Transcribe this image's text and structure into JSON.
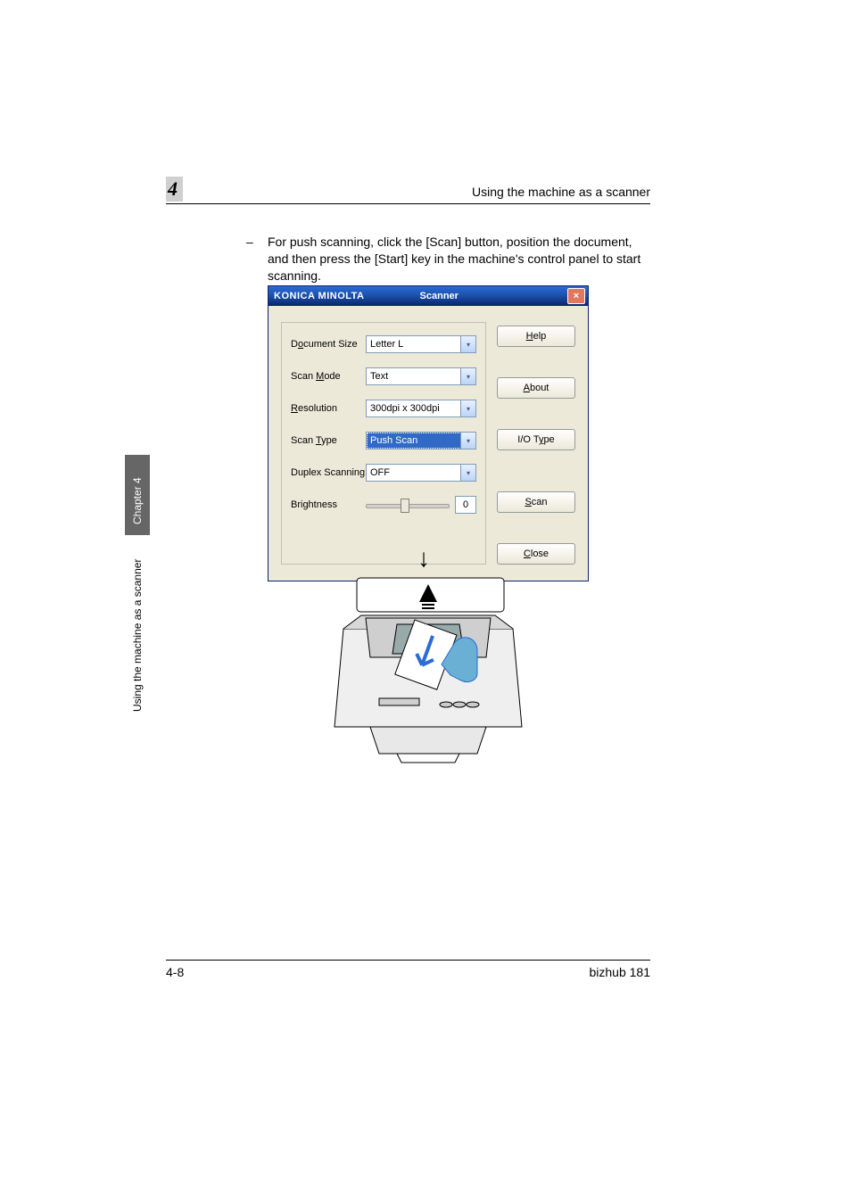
{
  "header": {
    "chapter_number": "4",
    "section_title": "Using the machine as a scanner"
  },
  "body": {
    "paragraph": "For push scanning, click the [Scan] button, position the document, and then press the [Start] key in the machine's control panel to start scanning."
  },
  "dialog": {
    "brand": "KONICA MINOLTA",
    "title": "Scanner",
    "labels": {
      "document_size": "Document Size",
      "scan_mode": "Scan Mode",
      "resolution": "Resolution",
      "scan_type": "Scan Type",
      "duplex": "Duplex Scanning",
      "brightness": "Brightness"
    },
    "values": {
      "document_size": "Letter L",
      "scan_mode": "Text",
      "resolution": "300dpi x 300dpi",
      "scan_type": "Push Scan",
      "duplex": "OFF",
      "brightness": "0"
    },
    "buttons": {
      "help": "Help",
      "about": "About",
      "iotype": "I/O Type",
      "scan": "Scan",
      "close": "Close"
    }
  },
  "side_tab": {
    "dark": "Chapter 4",
    "light": "Using the machine as a scanner"
  },
  "footer": {
    "left": "4-8",
    "right": "bizhub 181"
  }
}
